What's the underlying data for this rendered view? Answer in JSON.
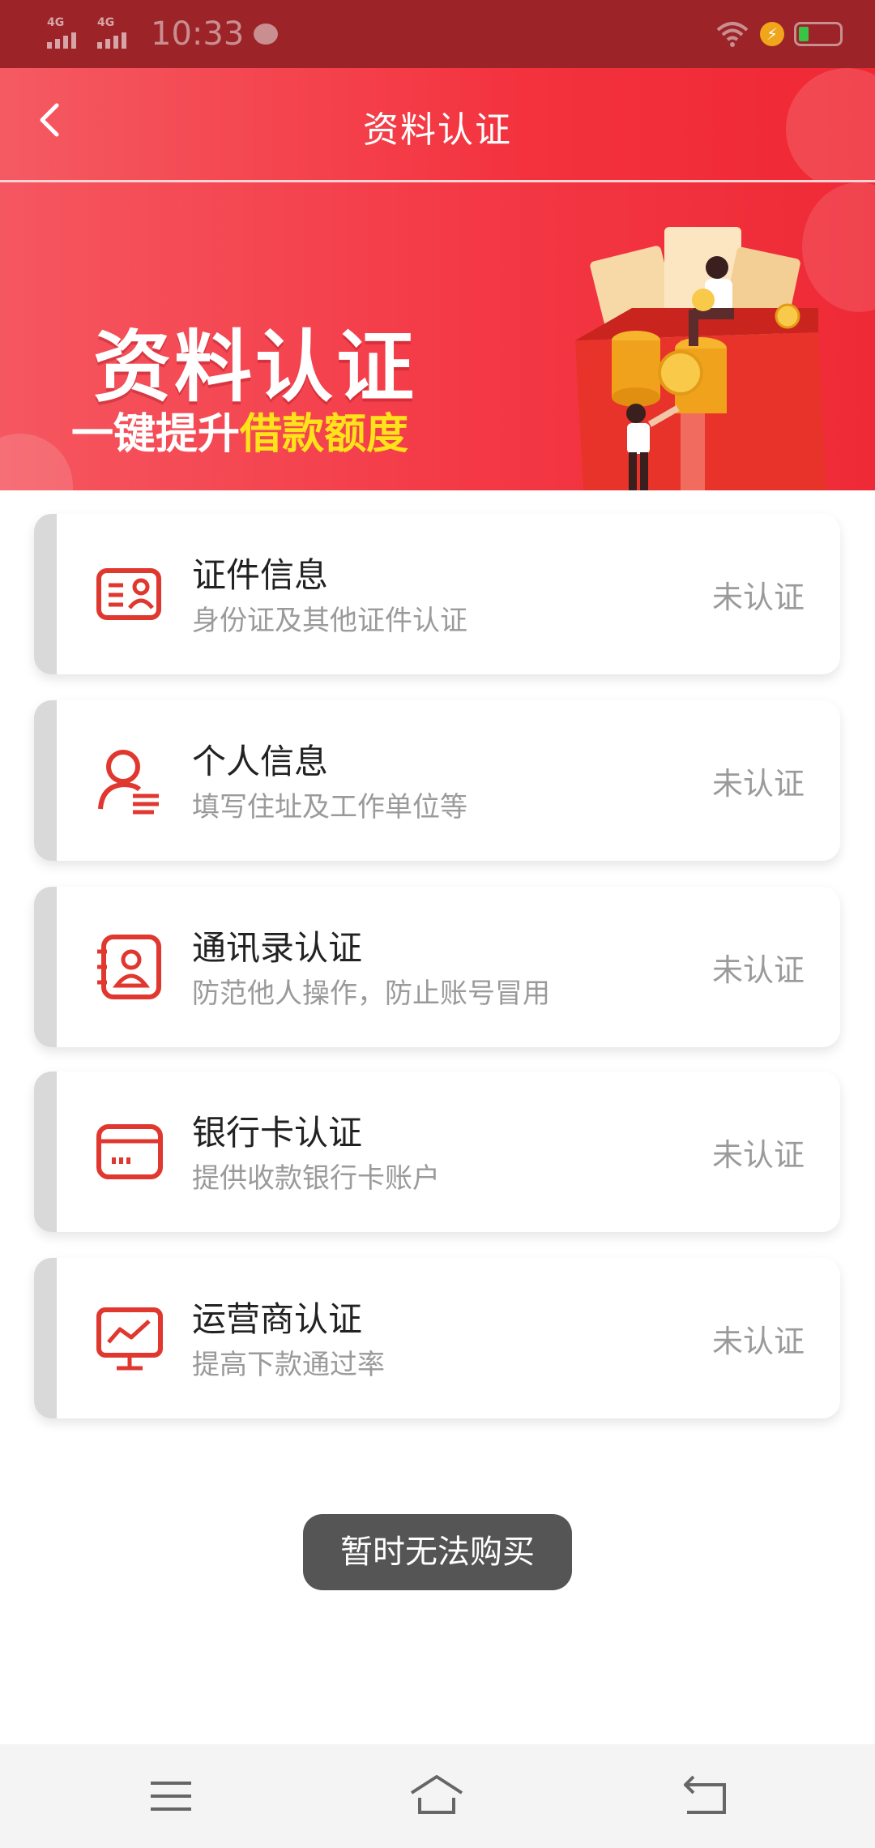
{
  "status_bar": {
    "signal1": "4G",
    "signal2": "4G",
    "time": "10:33"
  },
  "header": {
    "title": "资料认证"
  },
  "banner": {
    "title": "资料认证",
    "subtitle_plain": "一键提升",
    "subtitle_highlight": "借款额度"
  },
  "items": [
    {
      "title": "证件信息",
      "desc": "身份证及其他证件认证",
      "status": "未认证",
      "icon": "id-card-icon"
    },
    {
      "title": "个人信息",
      "desc": "填写住址及工作单位等",
      "status": "未认证",
      "icon": "person-icon"
    },
    {
      "title": "通讯录认证",
      "desc": "防范他人操作，防止账号冒用",
      "status": "未认证",
      "icon": "contacts-icon"
    },
    {
      "title": "银行卡认证",
      "desc": "提供收款银行卡账户",
      "status": "未认证",
      "icon": "bank-card-icon"
    },
    {
      "title": "运营商认证",
      "desc": "提高下款通过率",
      "status": "未认证",
      "icon": "monitor-chart-icon"
    }
  ],
  "toast": {
    "text": "暂时无法购买"
  },
  "colors": {
    "brand_red": "#f3323e",
    "icon_red": "#e0372f",
    "highlight_yellow": "#ffe21a"
  }
}
